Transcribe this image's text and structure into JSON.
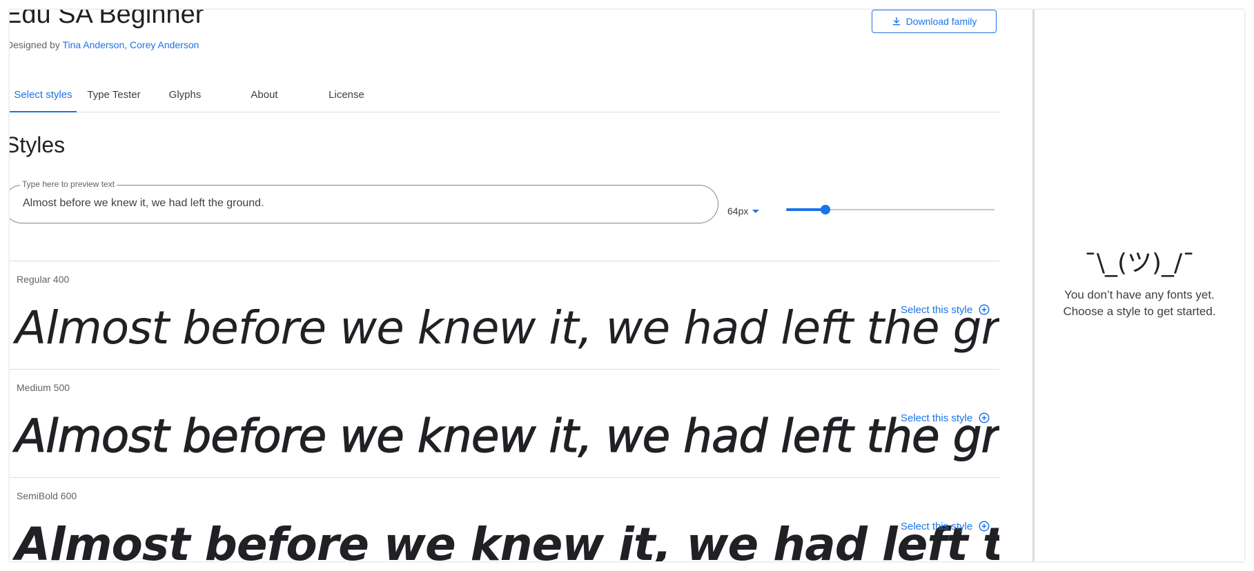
{
  "header": {
    "family_name": "Edu SA Beginner",
    "designed_by_prefix": "Designed by ",
    "designers": [
      "Tina Anderson",
      "Corey Anderson"
    ],
    "designer_separator": ", ",
    "download_label": "Download family"
  },
  "tabs": [
    {
      "label": "Select styles",
      "active": true
    },
    {
      "label": "Type Tester",
      "active": false
    },
    {
      "label": "Glyphs",
      "active": false
    },
    {
      "label": "About",
      "active": false
    },
    {
      "label": "License",
      "active": false
    }
  ],
  "styles_section": {
    "heading": "Styles",
    "preview_label": "Type here to preview text",
    "preview_value": "Almost before we knew it, we had left the ground.",
    "size_value": "64px",
    "size_slider_fraction": 0.19
  },
  "styles": [
    {
      "name": "Regular 400",
      "weight": 400,
      "sample": "Almost before we knew it, we had left the ground.",
      "select_label": "Select this style"
    },
    {
      "name": "Medium 500",
      "weight": 500,
      "sample": "Almost before we knew it, we had left the ground.",
      "select_label": "Select this style"
    },
    {
      "name": "SemiBold 600",
      "weight": 600,
      "sample": "Almost before we knew it, we had left the ground.",
      "select_label": "Select this style"
    }
  ],
  "side_panel": {
    "emoticon": "¯\\_(ツ)_/¯",
    "empty_line1": "You don’t have any fonts yet.",
    "empty_line2": "Choose a style to get started."
  },
  "colors": {
    "accent": "#1a73e8",
    "text": "#202124",
    "muted": "#5f6368",
    "divider": "#dadce0"
  }
}
